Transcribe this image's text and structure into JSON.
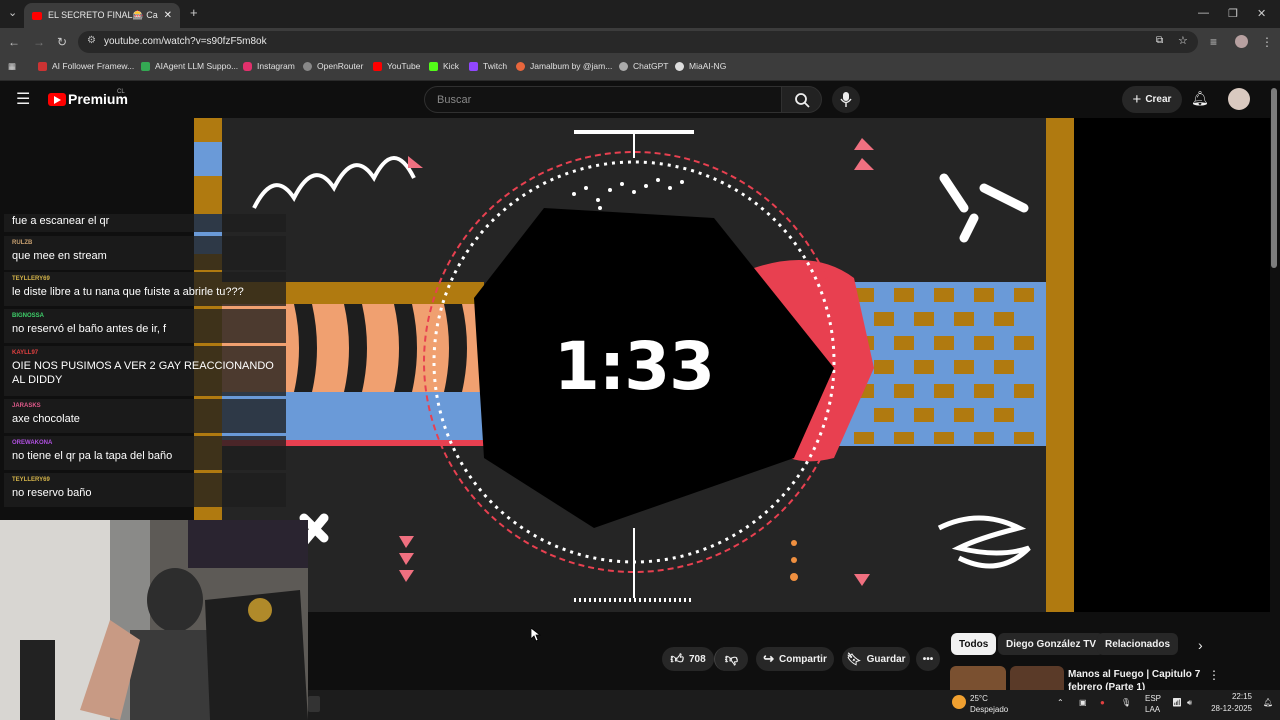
{
  "browser": {
    "tab_title": "EL SECRETO FINAL🎰 Capítulo",
    "url": "youtube.com/watch?v=s90fzF5m8ok",
    "bookmarks": [
      {
        "label": "AI Follower Framew...",
        "color": "#e8e8e8"
      },
      {
        "label": "AIAgent LLM Suppo...",
        "color": "#34a853"
      },
      {
        "label": "Instagram",
        "color": "#e1306c"
      },
      {
        "label": "OpenRouter",
        "color": "#cccccc"
      },
      {
        "label": "YouTube",
        "color": "#ff0000"
      },
      {
        "label": "Kick",
        "color": "#53fc18"
      },
      {
        "label": "Twitch",
        "color": "#9146ff"
      },
      {
        "label": "Jamalbum by @jam...",
        "color": "#e8663c"
      },
      {
        "label": "ChatGPT",
        "color": "#cccccc"
      },
      {
        "label": "MiaAI-NG",
        "color": "#e8e8e8"
      }
    ]
  },
  "youtube": {
    "logo_text": "Premium",
    "country": "CL",
    "search_placeholder": "Buscar",
    "create_label": "Crear"
  },
  "video": {
    "timer": "1:33"
  },
  "chat": [
    {
      "user": "",
      "text": "fue a escanear el qr",
      "color": "#d4b44a"
    },
    {
      "user": "RULZB",
      "text": "que mee en stream",
      "color": "#c8a070"
    },
    {
      "user": "TEYLLERY69",
      "text": "le diste libre a tu nana que fuiste a abrirle tu???",
      "color": "#d4b44a"
    },
    {
      "user": "BIGNOSSA",
      "text": "no reservó el baño antes de ir, f",
      "color": "#3ecf6a"
    },
    {
      "user": "KAYLL97",
      "text": "OIE NOS PUSIMOS A VER 2 GAY REACCIONANDO AL DIDDY",
      "color": "#e04040"
    },
    {
      "user": "JARASKS",
      "text": "axe chocolate",
      "color": "#e05a8a"
    },
    {
      "user": "OREWAKONA",
      "text": "no tiene el qr pa la tapa del baño",
      "color": "#b050e0"
    },
    {
      "user": "TEYLLERY69",
      "text": "no reservo baño",
      "color": "#d4b44a"
    }
  ],
  "actions": {
    "likes": "708",
    "share": "Compartir",
    "save": "Guardar"
  },
  "chips": [
    "Todos",
    "Diego González TV",
    "Relacionados"
  ],
  "recommendation": {
    "title": "Manos al Fuego | Capitulo 7",
    "subtitle": "febrero (Parte 1)"
  },
  "taskbar": {
    "temperature": "25°C",
    "weather": "Despejado",
    "lang": "ESP",
    "lang2": "LAA",
    "time": "22:15",
    "date": "28-12-2025"
  }
}
